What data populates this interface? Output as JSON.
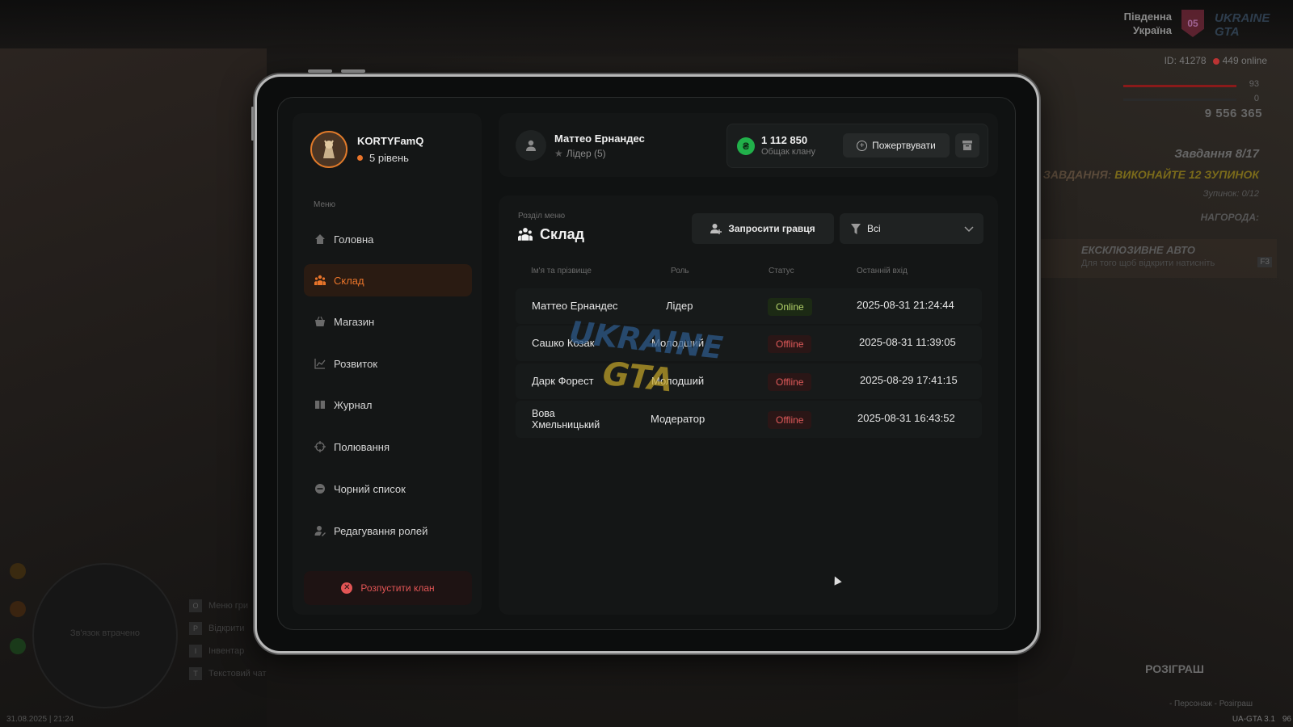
{
  "hud": {
    "region_line1": "Південна",
    "region_line2": "Україна",
    "region_code": "05",
    "logo": "UKRAINE GTA",
    "player_id": "ID: 41278",
    "online": "449 online",
    "health": "93",
    "armor": "0",
    "money": "9 556 365",
    "task_counter": "Завдання 8/17",
    "task_label": "ЗАВДАННЯ:",
    "task_text": "ВИКОНАЙТЕ 12 ЗУПИНОК",
    "stops": "Зупинок: 0/12",
    "reward": "НАГОРОДА:",
    "exclusive_title": "ЕКСКЛЮЗИВНЕ АВТО",
    "exclusive_sub": "Для того щоб відкрити натисніть",
    "exclusive_key": "F3",
    "giveaway": "РОЗІГРАШ",
    "giveaway_sub": "- Персонаж - Розіграш",
    "version": "UA-GTA 3.1",
    "corner": "96",
    "connection_lost": "Зв'язок втрачено",
    "date": "31.08.2025 | 21:24",
    "keys": [
      {
        "key": "O",
        "label": "Меню гри"
      },
      {
        "key": "P",
        "label": "Відкрити"
      },
      {
        "key": "I",
        "label": "Інвентар"
      },
      {
        "key": "T",
        "label": "Текстовий чат"
      }
    ]
  },
  "clan": {
    "name": "KORTYFamQ",
    "level": "5 рівень"
  },
  "menu": {
    "caption": "Меню",
    "items": [
      {
        "label": "Головна",
        "icon": "home-icon"
      },
      {
        "label": "Склад",
        "icon": "members-icon",
        "active": true
      },
      {
        "label": "Магазин",
        "icon": "basket-icon"
      },
      {
        "label": "Розвиток",
        "icon": "chart-icon"
      },
      {
        "label": "Журнал",
        "icon": "book-icon"
      },
      {
        "label": "Полювання",
        "icon": "crosshair-icon"
      },
      {
        "label": "Чорний список",
        "icon": "blocked-icon"
      },
      {
        "label": "Редагування ролей",
        "icon": "user-edit-icon"
      }
    ],
    "disband": "Розпустити клан"
  },
  "user": {
    "name": "Маттео Ернандес",
    "role": "Лідер (5)"
  },
  "wallet": {
    "currency_symbol": "₴",
    "amount": "1 112 850",
    "label": "Общак клану",
    "donate": "Пожертвувати"
  },
  "section": {
    "caption": "Розділ меню",
    "title": "Склад",
    "invite": "Запросити гравця",
    "filter": "Всі"
  },
  "table": {
    "headers": [
      "Ім'я та прізвище",
      "Роль",
      "Статус",
      "Останній вхід"
    ],
    "rows": [
      {
        "name": "Маттео Ернандес",
        "role": "Лідер",
        "status": "Online",
        "last": "2025-08-31 21:24:44"
      },
      {
        "name": "Сашко Козак",
        "role": "Молодший",
        "status": "Offline",
        "last": "2025-08-31 11:39:05"
      },
      {
        "name": "Дарк Форест",
        "role": "Молодший",
        "status": "Offline",
        "last": "2025-08-29 17:41:15"
      },
      {
        "name": "Вова Хмельницький",
        "role": "Модератор",
        "status": "Offline",
        "last": "2025-08-31 16:43:52"
      }
    ]
  },
  "watermark": "UKRAINE GTA",
  "colors": {
    "accent": "#e8742a",
    "online": "#b4d36a",
    "offline": "#e05a5a",
    "coin": "#21b04a"
  }
}
